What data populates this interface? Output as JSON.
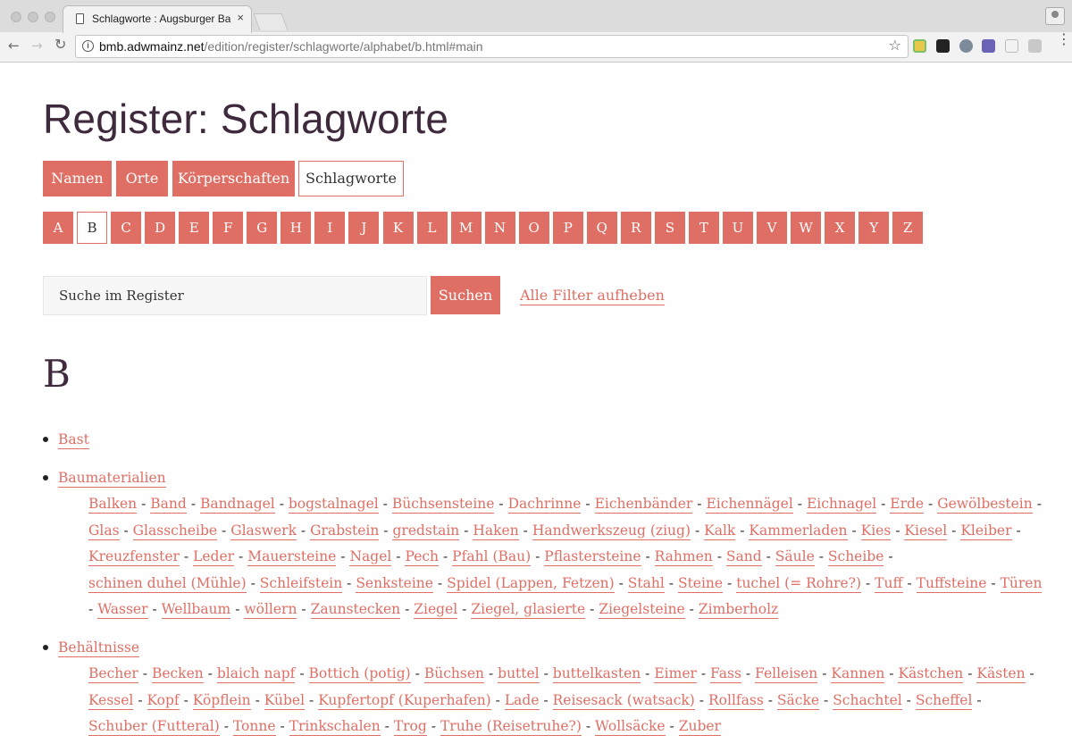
{
  "browser": {
    "tab_title": "Schlagworte : Augsburger Bau",
    "tab_close": "×",
    "url_host": "bmb.adwmainz.net",
    "url_path": "/edition/register/schlagworte/alphabet/b.html#main",
    "back": "←",
    "forward": "→",
    "reload": "↻",
    "info": "i",
    "star": "☆",
    "menu": "⋮"
  },
  "page": {
    "title": "Register: Schlagworte",
    "category_tabs": [
      {
        "label": "Namen",
        "active": false
      },
      {
        "label": "Orte",
        "active": false
      },
      {
        "label": "Körperschaften",
        "active": false
      },
      {
        "label": "Schlagworte",
        "active": true
      }
    ],
    "letters": [
      "A",
      "B",
      "C",
      "D",
      "E",
      "F",
      "G",
      "H",
      "I",
      "J",
      "K",
      "L",
      "M",
      "N",
      "O",
      "P",
      "Q",
      "R",
      "S",
      "T",
      "U",
      "V",
      "W",
      "X",
      "Y",
      "Z"
    ],
    "active_letter": "B",
    "search_placeholder": "Suche im Register",
    "search_button": "Suchen",
    "reset_filters": "Alle Filter aufheben",
    "section_letter": "B",
    "separator": "-",
    "entries": [
      {
        "term": "Bast",
        "sub": []
      },
      {
        "term": "Baumaterialien",
        "sub": [
          "Balken",
          "Band",
          "Bandnagel",
          "bogstalnagel",
          "Büchsensteine",
          "Dachrinne",
          "Eichenbänder",
          "Eichennägel",
          "Eichnagel",
          "Erde",
          "Gewölbestein",
          "Glas",
          "Glasscheibe",
          "Glaswerk",
          "Grabstein",
          "gredstain",
          "Haken",
          "Handwerkszeug (ziug)",
          "Kalk",
          "Kammerladen",
          "Kies",
          "Kiesel",
          "Kleiber",
          "Kreuzfenster",
          "Leder",
          "Mauersteine",
          "Nagel",
          "Pech",
          "Pfahl (Bau)",
          "Pflastersteine",
          "Rahmen",
          "Sand",
          "Säule",
          "Scheibe",
          "schinen duhel (Mühle)",
          "Schleifstein",
          "Senksteine",
          "Spidel (Lappen, Fetzen)",
          "Stahl",
          "Steine",
          "tuchel (= Rohre?)",
          "Tuff",
          "Tuffsteine",
          "Türen",
          "Wasser",
          "Wellbaum",
          "wöllern",
          "Zaunstecken",
          "Ziegel",
          "Ziegel, glasierte",
          "Ziegelsteine",
          "Zimberholz"
        ]
      },
      {
        "term": "Behältnisse",
        "sub": [
          "Becher",
          "Becken",
          "blaich napf",
          "Bottich (potig)",
          "Büchsen",
          "buttel",
          "buttelkasten",
          "Eimer",
          "Fass",
          "Felleisen",
          "Kannen",
          "Kästchen",
          "Kästen",
          "Kessel",
          "Kopf",
          "Köpflein",
          "Kübel",
          "Kupfertopf (Kuperhafen)",
          "Lade",
          "Reisesack (watsack)",
          "Rollfass",
          "Säcke",
          "Schachtel",
          "Scheffel",
          "Schuber (Futteral)",
          "Tonne",
          "Trinkschalen",
          "Trog",
          "Truhe (Reisetruhe?)",
          "Wollsäcke",
          "Zuber"
        ]
      }
    ]
  }
}
